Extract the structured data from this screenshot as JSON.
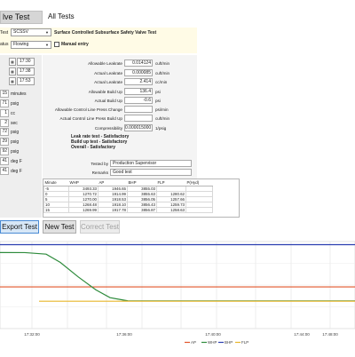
{
  "tabs": [
    {
      "label": "lve Test"
    },
    {
      "label": "All Tests"
    }
  ],
  "header": {
    "test_label": "Test",
    "test_value": "SCSSV",
    "test_desc": "Surface Controlled Subsurface Safety Valve Test",
    "status_label": "atus",
    "status_value": "Flowing",
    "manual_entry_label": "Manual entry"
  },
  "left": {
    "times": [
      "17:30",
      "17:38",
      "17:53"
    ],
    "durations": [
      {
        "value": "15",
        "unit": "minutes"
      },
      {
        "value": "71",
        "unit": "psig"
      },
      {
        "value": "1",
        "unit": "cc"
      },
      {
        "value": "2",
        "unit": "sec"
      }
    ],
    "pressures": [
      {
        "value": "72",
        "unit": "psig"
      },
      {
        "value": "29",
        "unit": "psig"
      },
      {
        "value": "92",
        "unit": "psig"
      },
      {
        "value": "41",
        "unit": "deg F"
      },
      {
        "value": "41",
        "unit": "deg F"
      }
    ]
  },
  "results": [
    {
      "label": "Allowable Leakrate",
      "value": "0.014124",
      "unit": "cuft/min"
    },
    {
      "label": "Actual Leakrate",
      "value": "0.000085",
      "unit": "cuft/min"
    },
    {
      "label": "Actual Leakrate",
      "value": "2.414",
      "unit": "cc/min"
    },
    {
      "label": "Allowable Build Up",
      "value": "136.4",
      "unit": "psi"
    },
    {
      "label": "Actual Build Up",
      "value": "-0.6",
      "unit": "psi"
    },
    {
      "label": "Allowable Control Line Press Change",
      "value": "",
      "unit": "psi/min"
    },
    {
      "label": "Actual Control Line Press Build Up",
      "value": "",
      "unit": "cuft/min"
    },
    {
      "label": "Compressibility",
      "value": "0.000015000",
      "unit": "1/psig"
    }
  ],
  "status": {
    "leak": "Leak rate test - Satisfactory",
    "buildup": "Build up test - Satisfactory",
    "overall": "Overall - Satisfactory"
  },
  "tested_by": {
    "label": "Tested by",
    "value": "Production Supervisor"
  },
  "remarks": {
    "label": "Remarks",
    "value": "Good test"
  },
  "table": {
    "headers": [
      "Minute",
      "WHP",
      "AP",
      "BHP",
      "FLP",
      "P(Hyd)"
    ],
    "rows": [
      [
        "-5",
        "3493.33",
        "1946.65",
        "3855.03",
        "",
        ""
      ],
      [
        "0",
        "1270.72",
        "1914.99",
        "3855.63",
        "1280.62",
        ""
      ],
      [
        "5",
        "1270.00",
        "1918.53",
        "3856.05",
        "1257.66",
        ""
      ],
      [
        "10",
        "1268.48",
        "1918.10",
        "3856.43",
        "1259.73",
        ""
      ],
      [
        "15",
        "1269.99",
        "1917.78",
        "3856.87",
        "1258.63",
        ""
      ]
    ]
  },
  "buttons": {
    "export": "Export Test",
    "new": "New Test",
    "correct": "Correct Test"
  },
  "chart_data": {
    "type": "line",
    "x_ticks": [
      "17:32:00",
      "17:36:00",
      "17:40:00",
      "17:44:00",
      "17:48:00"
    ],
    "ylim": [
      0,
      4000
    ],
    "series": [
      {
        "name": "AP",
        "color": "#e2552a",
        "x": [
          0,
          1
        ],
        "y": [
          1915,
          1915
        ]
      },
      {
        "name": "WHP",
        "color": "#2e8b3c",
        "x": [
          0,
          0.07,
          0.13,
          0.17,
          0.22,
          0.27,
          0.31,
          0.36,
          1
        ],
        "y": [
          3495,
          3493,
          3420,
          3040,
          2380,
          1780,
          1420,
          1275,
          1270
        ]
      },
      {
        "name": "BHP",
        "color": "#2b3fb0",
        "x": [
          0,
          1
        ],
        "y": [
          3856,
          3856
        ]
      },
      {
        "name": "FLP",
        "color": "#e8b62a",
        "x": [
          0.11,
          1
        ],
        "y": [
          1258,
          1258
        ]
      }
    ],
    "legend": "bottom-right"
  }
}
